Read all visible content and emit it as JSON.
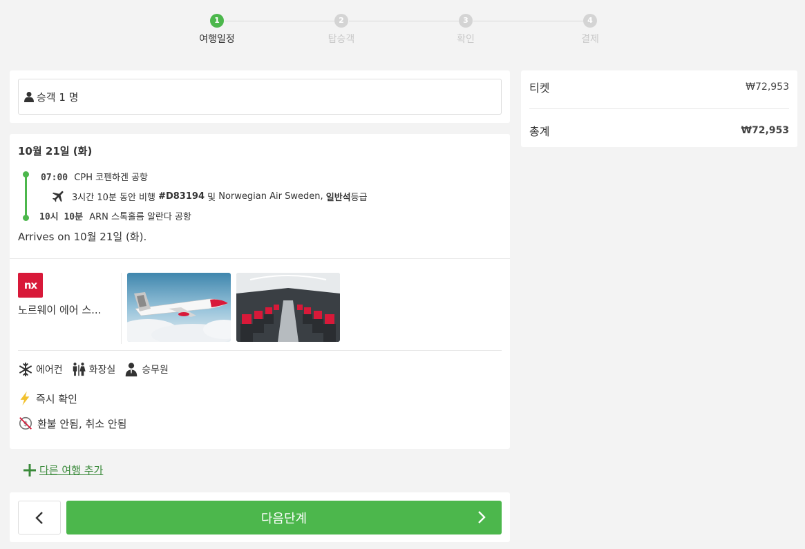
{
  "stepper": {
    "steps": [
      {
        "num": "1",
        "label": "여행일정"
      },
      {
        "num": "2",
        "label": "탑승객"
      },
      {
        "num": "3",
        "label": "확인"
      },
      {
        "num": "4",
        "label": "결제"
      }
    ]
  },
  "passengers": {
    "label": "승객 1 명"
  },
  "trip": {
    "date": "10월 21일 (화)",
    "departure": {
      "time": "07:00",
      "airport": "CPH 코펜하겐 공항"
    },
    "flight": {
      "duration_text": "3시간 10분 동안 비행",
      "number": "#D83194",
      "conj": "및",
      "airline_text": "Norwegian Air Sweden,",
      "class": "일반석",
      "class_suffix": "등급"
    },
    "arrival": {
      "time": "10시 10분",
      "airport": "ARN 스톡홀름 알란다 공항"
    },
    "arrives_note": "Arrives on 10월 21일 (화).",
    "airline": {
      "logo_text": "nx",
      "name": "노르웨이 에어 스..."
    },
    "amenities": [
      {
        "icon": "snowflake-icon",
        "label": "에어컨"
      },
      {
        "icon": "restroom-icon",
        "label": "화장실"
      },
      {
        "icon": "attendant-icon",
        "label": "승무원"
      }
    ],
    "instant_confirm": "즉시 확인",
    "refund_policy": "환불 안됨, 취소 안됨"
  },
  "add_trip": {
    "label": "다른 여행 추가"
  },
  "nav": {
    "next_label": "다음단계"
  },
  "summary": {
    "ticket_label": "티켓",
    "ticket_value": "₩72,953",
    "total_label": "총계",
    "total_value": "₩72,953"
  },
  "colors": {
    "accent": "#4cb74c",
    "brand_red": "#d81939",
    "inactive": "#d4d4d4"
  }
}
